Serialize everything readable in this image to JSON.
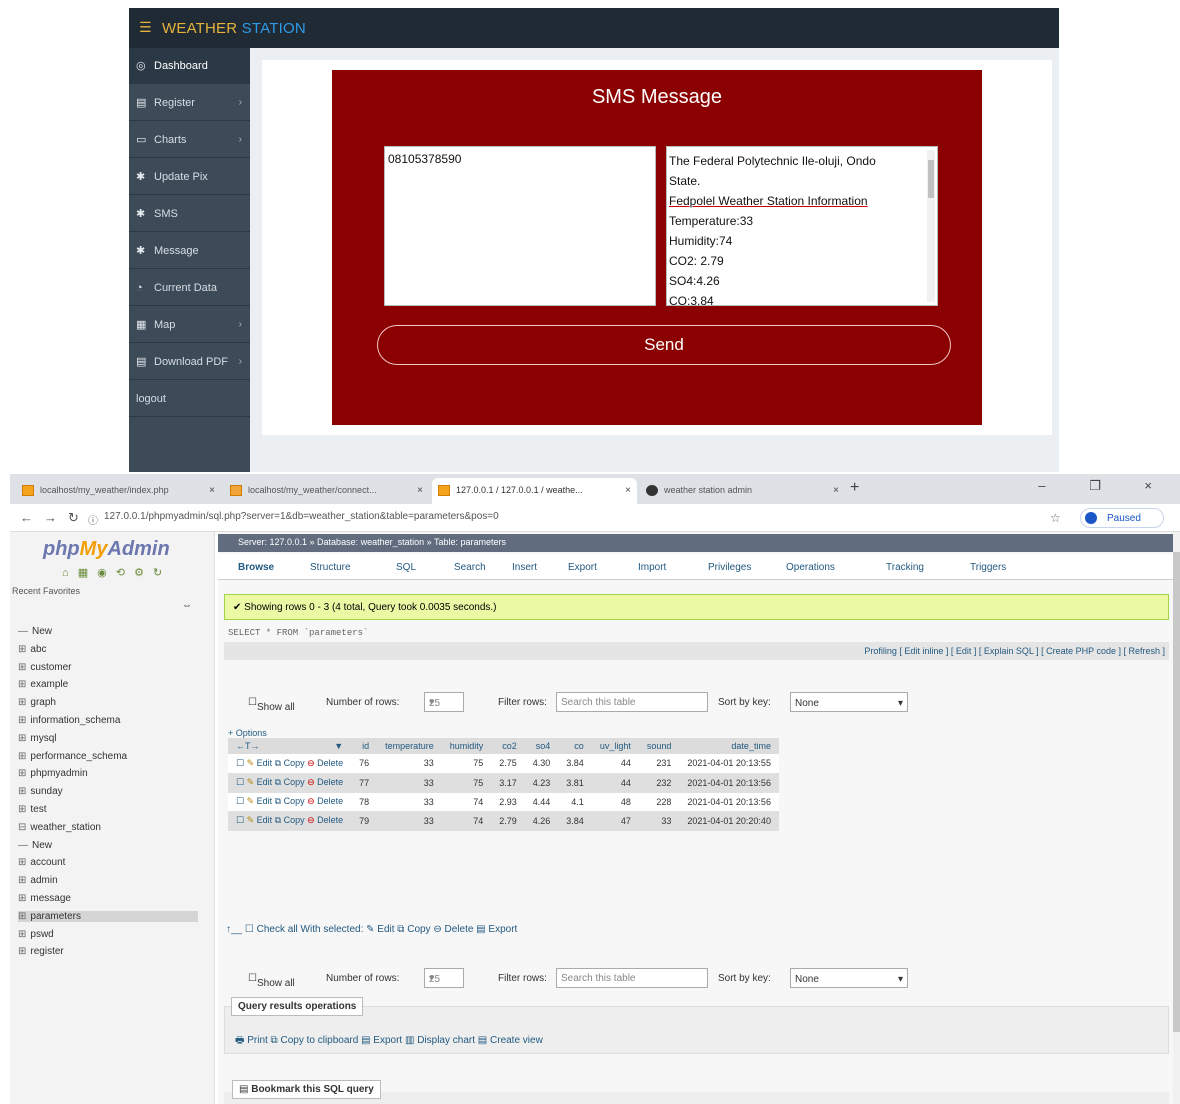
{
  "ws": {
    "title_part1": "WEATHER",
    "title_part2": "STATION",
    "menu_icon": "☰",
    "nav": [
      {
        "label": "Dashboard",
        "icon": "dashboard-icon",
        "glyph": "◎",
        "chevron": ""
      },
      {
        "label": "Register",
        "icon": "register-icon",
        "glyph": "▤",
        "chevron": "›"
      },
      {
        "label": "Charts",
        "icon": "charts-icon",
        "glyph": "▭",
        "chevron": "›"
      },
      {
        "label": "Update Pix",
        "icon": "gear-icon",
        "glyph": "✱",
        "chevron": ""
      },
      {
        "label": "SMS",
        "icon": "gear-icon",
        "glyph": "✱",
        "chevron": ""
      },
      {
        "label": "Message",
        "icon": "gear-icon",
        "glyph": "✱",
        "chevron": ""
      },
      {
        "label": "Current Data",
        "icon": "pie-icon",
        "glyph": "◔",
        "chevron": ""
      },
      {
        "label": "Map",
        "icon": "map-icon",
        "glyph": "▦",
        "chevron": "›"
      },
      {
        "label": "Download PDF",
        "icon": "pdf-icon",
        "glyph": "▤",
        "chevron": "›"
      },
      {
        "label": "logout",
        "icon": "",
        "glyph": "",
        "chevron": ""
      }
    ],
    "sms": {
      "heading": "SMS Message",
      "phone_value": "08105378590",
      "message_lines": [
        "The Federal Polytechnic Ile-oluji, Ondo",
        "State.",
        "Fedpolel Weather Station Information",
        "Temperature:33",
        "Humidity:74",
        "CO2: 2.79",
        "SO4:4.26",
        "CO:3.84"
      ],
      "send_label": "Send"
    }
  },
  "browser": {
    "tabs": [
      {
        "label": "localhost/my_weather/index.php",
        "close": "×"
      },
      {
        "label": "localhost/my_weather/connect...",
        "close": "×"
      },
      {
        "label": "127.0.0.1 / 127.0.0.1 / weathe...",
        "close": "×"
      },
      {
        "label": "weather station admin",
        "close": "×"
      }
    ],
    "new_tab": "+",
    "window_controls": "–  ❐  ×",
    "url": "127.0.0.1/phpmyadmin/sql.php?server=1&db=weather_station&table=parameters&pos=0",
    "paused": "Paused"
  },
  "pma": {
    "logo_php": "php",
    "logo_my": "My",
    "logo_admin": "Admin",
    "recent": "Recent   Favorites",
    "databases": [
      {
        "name": "New",
        "prefix": "—",
        "sel": false
      },
      {
        "name": "abc",
        "prefix": "⊞",
        "sel": false
      },
      {
        "name": "customer",
        "prefix": "⊞",
        "sel": false
      },
      {
        "name": "example",
        "prefix": "⊞",
        "sel": false
      },
      {
        "name": "graph",
        "prefix": "⊞",
        "sel": false
      },
      {
        "name": "information_schema",
        "prefix": "⊞",
        "sel": false
      },
      {
        "name": "mysql",
        "prefix": "⊞",
        "sel": false
      },
      {
        "name": "performance_schema",
        "prefix": "⊞",
        "sel": false
      },
      {
        "name": "phpmyadmin",
        "prefix": "⊞",
        "sel": false
      },
      {
        "name": "sunday",
        "prefix": "⊞",
        "sel": false
      },
      {
        "name": "test",
        "prefix": "⊞",
        "sel": false
      },
      {
        "name": "weather_station",
        "prefix": "⊟",
        "sel": false
      },
      {
        "name": "New",
        "prefix": "   —",
        "sel": false
      },
      {
        "name": "account",
        "prefix": "   ⊞",
        "sel": false
      },
      {
        "name": "admin",
        "prefix": "   ⊞",
        "sel": false
      },
      {
        "name": "message",
        "prefix": "   ⊞",
        "sel": false
      },
      {
        "name": "parameters",
        "prefix": "   ⊞",
        "sel": true
      },
      {
        "name": "pswd",
        "prefix": "   ⊞",
        "sel": false
      },
      {
        "name": "register",
        "prefix": "   ⊞",
        "sel": false
      }
    ],
    "breadcrumb": "Server: 127.0.0.1 » Database: weather_station » Table: parameters",
    "tabs": [
      "Browse",
      "Structure",
      "SQL",
      "Search",
      "Insert",
      "Export",
      "Import",
      "Privileges",
      "Operations",
      "Tracking",
      "Triggers"
    ],
    "success": "✔ Showing rows 0 - 3 (4 total, Query took 0.0035 seconds.)",
    "sql": "SELECT * FROM `parameters`",
    "profiling": "Profiling [ Edit inline ] [ Edit ] [ Explain SQL ] [ Create PHP code ] [ Refresh ]",
    "filter": {
      "show_all": "Show all",
      "rows_label": "Number of rows:",
      "rows_value": "25",
      "filter_label": "Filter rows:",
      "filter_placeholder": "Search this table",
      "sort_label": "Sort by key:",
      "sort_value": "None"
    },
    "options": "+ Options",
    "columns": [
      "←T→",
      "▼",
      "id",
      "temperature",
      "humidity",
      "co2",
      "so4",
      "co",
      "uv_light",
      "sound",
      "date_time"
    ],
    "rows": [
      {
        "id": "76",
        "temperature": "33",
        "humidity": "75",
        "co2": "2.75",
        "so4": "4.30",
        "co": "3.84",
        "uv_light": "44",
        "sound": "231",
        "date_time": "2021-04-01 20:13:55"
      },
      {
        "id": "77",
        "temperature": "33",
        "humidity": "75",
        "co2": "3.17",
        "so4": "4.23",
        "co": "3.81",
        "uv_light": "44",
        "sound": "232",
        "date_time": "2021-04-01 20:13:56"
      },
      {
        "id": "78",
        "temperature": "33",
        "humidity": "74",
        "co2": "2.93",
        "so4": "4.44",
        "co": "4.1",
        "uv_light": "48",
        "sound": "228",
        "date_time": "2021-04-01 20:13:56"
      },
      {
        "id": "79",
        "temperature": "33",
        "humidity": "74",
        "co2": "2.79",
        "so4": "4.26",
        "co": "3.84",
        "uv_light": "47",
        "sound": "33",
        "date_time": "2021-04-01 20:20:40"
      }
    ],
    "row_actions": {
      "edit": "Edit",
      "copy": "Copy",
      "delete": "Delete"
    },
    "with_selected": "↑__   ☐ Check all     With selected:   ✎ Edit    ⧉ Copy    ⊖ Delete    ▤ Export",
    "qro_title": "Query results operations",
    "qro_links": "🖶 Print   ⧉ Copy to clipboard   ▤ Export   ▥ Display chart   ▤ Create view",
    "bookmark_title": "▤ Bookmark this SQL query"
  }
}
